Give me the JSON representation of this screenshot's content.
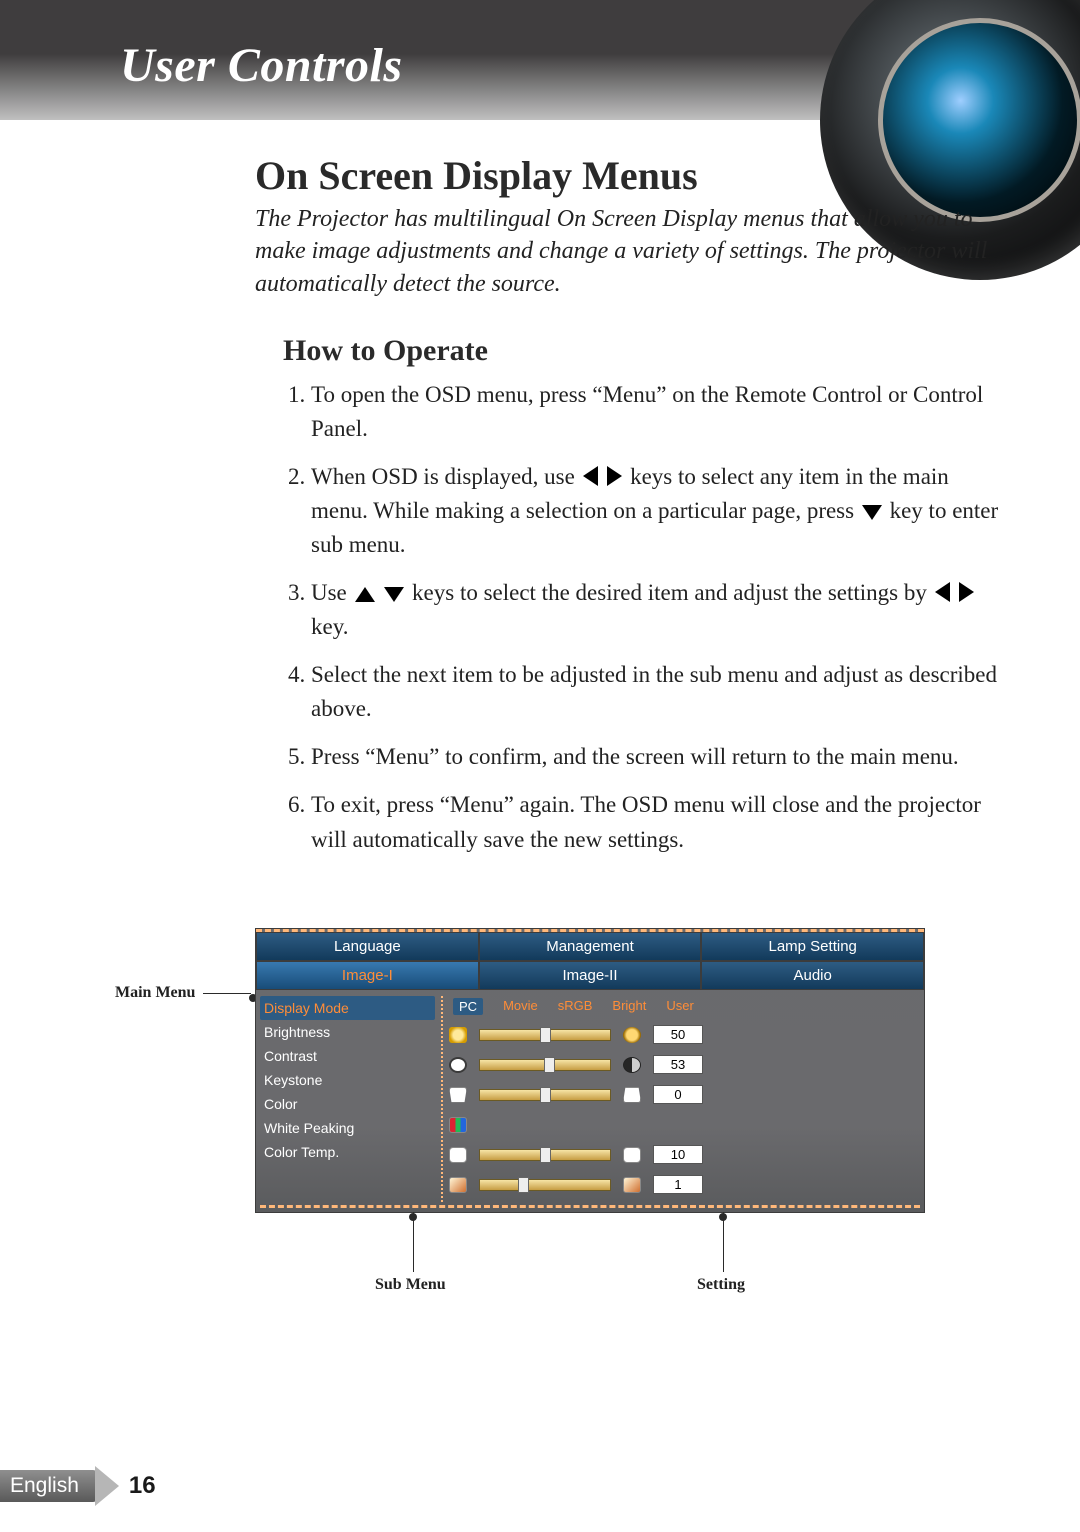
{
  "header": {
    "title": "User Controls"
  },
  "section": {
    "title": "On Screen Display Menus",
    "intro": "The Projector has multilingual On Screen Display menus that allow you to make image adjustments and change a variety of settings. The projector will automatically detect the source.",
    "subtitle": "How to Operate",
    "steps": {
      "s1": "To open the OSD menu, press “Menu” on the Remote Control or Control Panel.",
      "s2a": "When OSD is displayed, use ",
      "s2b": " keys to select any item in the main menu.  While making a selection on a particular page, press ",
      "s2c": " key to enter sub menu.",
      "s3a": "Use ",
      "s3b": " keys to select the desired item and adjust the settings by ",
      "s3c": " key.",
      "s4": "Select the next item to be adjusted in the sub menu and adjust as described above.",
      "s5": "Press “Menu” to confirm, and the screen will return to the main menu.",
      "s6": "To exit, press “Menu” again.  The OSD menu will close and the projector will automatically save the new settings."
    }
  },
  "osd": {
    "tabs_top": [
      "Language",
      "Management",
      "Lamp Setting"
    ],
    "tabs_bottom": [
      "Image-I",
      "Image-II",
      "Audio"
    ],
    "tabs_bottom_selected": 0,
    "submenu": [
      "Display Mode",
      "Brightness",
      "Contrast",
      "Keystone",
      "Color",
      "White Peaking",
      "Color Temp."
    ],
    "submenu_selected": 0,
    "display_modes": [
      "PC",
      "Movie",
      "sRGB",
      "Bright",
      "User"
    ],
    "display_mode_selected": 0,
    "settings": [
      {
        "name": "Brightness",
        "value": 50,
        "min": 0,
        "max": 100,
        "icon_l": "sun",
        "icon_r": "minidot"
      },
      {
        "name": "Contrast",
        "value": 53,
        "min": 0,
        "max": 100,
        "icon_l": "circ",
        "icon_r": "halfc"
      },
      {
        "name": "Keystone",
        "value": 0,
        "min": -50,
        "max": 50,
        "icon_l": "key1",
        "icon_r": "key2"
      },
      {
        "name": "Color",
        "noslider": true,
        "icon_l": "rgb"
      },
      {
        "name": "White Peaking",
        "value": 10,
        "min": 0,
        "max": 20,
        "icon_l": "wp",
        "icon_r": "wp"
      },
      {
        "name": "Color Temp.",
        "value": 1,
        "min": 0,
        "max": 3,
        "icon_l": "ct",
        "icon_r": "ct"
      }
    ],
    "labels": {
      "main_menu": "Main Menu",
      "sub_menu": "Sub Menu",
      "setting": "Setting"
    }
  },
  "footer": {
    "language": "English",
    "page": "16"
  }
}
